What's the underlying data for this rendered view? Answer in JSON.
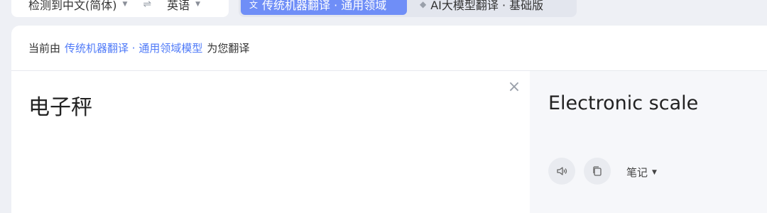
{
  "language_bar": {
    "source_lang": "检测到中文(简体)",
    "target_lang": "英语",
    "swap_symbol": "⇌"
  },
  "modes": {
    "machine_label": "传统机器翻译 · 通用领域",
    "ai_label": "AI大模型翻译 · 基础版"
  },
  "notice": {
    "prefix": "当前由",
    "model": "传统机器翻译 · 通用领域模型",
    "suffix": "为您翻译"
  },
  "source": {
    "text": "电子秤",
    "clear_symbol": "×"
  },
  "target": {
    "text": "Electronic scale",
    "notes_label": "笔记"
  },
  "colors": {
    "accent": "#6f8ef7",
    "link": "#4f7af8"
  }
}
